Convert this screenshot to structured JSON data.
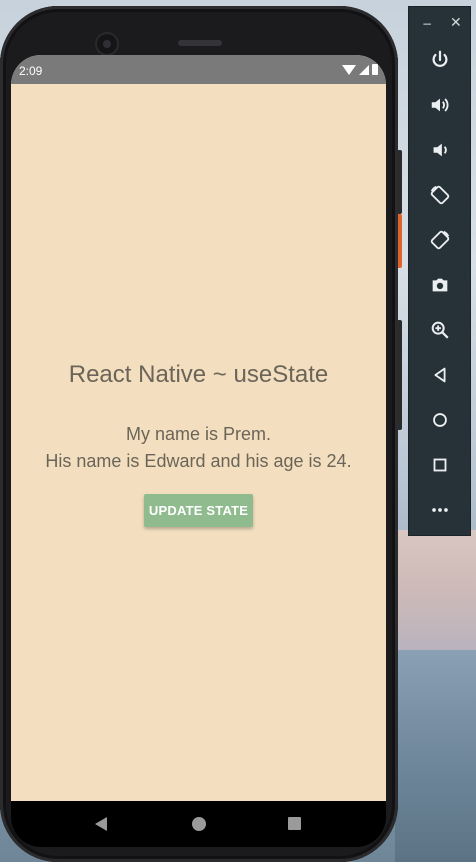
{
  "status_bar": {
    "time": "2:09"
  },
  "app": {
    "title": "React Native ~ useState",
    "line1": "My name is Prem.",
    "line2": "His name is Edward and his age is 24.",
    "button_label": "UPDATE STATE",
    "background_color": "#f3dfbf",
    "button_color": "#8fbb8e",
    "text_color": "#6b6559"
  },
  "emulator_toolbar": {
    "minimize_label": "−",
    "close_label": "✕",
    "buttons": [
      {
        "icon": "power-icon"
      },
      {
        "icon": "volume-up-icon"
      },
      {
        "icon": "volume-down-icon"
      },
      {
        "icon": "rotate-left-icon"
      },
      {
        "icon": "rotate-right-icon"
      },
      {
        "icon": "camera-icon"
      },
      {
        "icon": "zoom-icon"
      },
      {
        "icon": "back-icon"
      },
      {
        "icon": "home-icon"
      },
      {
        "icon": "overview-icon"
      },
      {
        "icon": "more-icon"
      }
    ]
  },
  "nav_bar": {
    "buttons": [
      {
        "icon": "back-triangle-icon"
      },
      {
        "icon": "home-circle-icon"
      },
      {
        "icon": "recents-square-icon"
      }
    ]
  }
}
